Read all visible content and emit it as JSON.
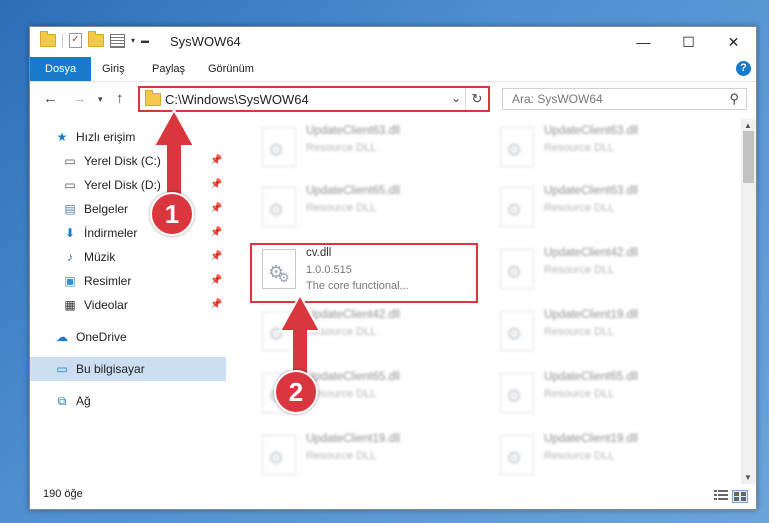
{
  "window": {
    "title": "SysWOW64",
    "controls": {
      "minimize": "—",
      "maximize": "☐",
      "close": "✕"
    }
  },
  "ribbon": {
    "tabs": [
      "Dosya",
      "Giriş",
      "Paylaş",
      "Görünüm"
    ],
    "help": "?"
  },
  "address": {
    "path": "C:\\Windows\\SysWOW64",
    "search_placeholder": "Ara: SysWOW64"
  },
  "nav": {
    "quick_access": "Hızlı erişim",
    "items": [
      "Yerel Disk (C:)",
      "Yerel Disk (D:)",
      "Belgeler",
      "İndirmeler",
      "Müzik",
      "Resimler",
      "Videolar"
    ],
    "onedrive": "OneDrive",
    "this_pc": "Bu bilgisayar",
    "network": "Ağ"
  },
  "files": {
    "left": [
      {
        "name": "UpdateClient63.dll",
        "desc": "Resource DLL"
      },
      {
        "name": "UpdateClient65.dll",
        "desc": "Resource DLL"
      },
      {
        "name": "cv.dll",
        "version": "1.0.0.515",
        "desc": "The core functional..."
      },
      {
        "name": "UpdateClient42.dll",
        "desc": "Resource DLL"
      },
      {
        "name": "UpdateClient65.dll",
        "desc": "Resource DLL"
      },
      {
        "name": "UpdateClient19.dll",
        "desc": "Resource DLL"
      }
    ],
    "right": [
      {
        "name": "UpdateClient63.dll",
        "desc": "Resource DLL"
      },
      {
        "name": "UpdateClient63.dll",
        "desc": "Resource DLL"
      },
      {
        "name": "UpdateClient42.dll",
        "desc": "Resource DLL"
      },
      {
        "name": "UpdateClient19.dll",
        "desc": "Resource DLL"
      },
      {
        "name": "UpdateClient65.dll",
        "desc": "Resource DLL"
      },
      {
        "name": "UpdateClient19.dll",
        "desc": "Resource DLL"
      }
    ]
  },
  "status": {
    "count": "190 öğe"
  },
  "annotations": {
    "step1": "1",
    "step2": "2"
  },
  "colors": {
    "accent": "#1979ca",
    "highlight": "#d9363e"
  }
}
